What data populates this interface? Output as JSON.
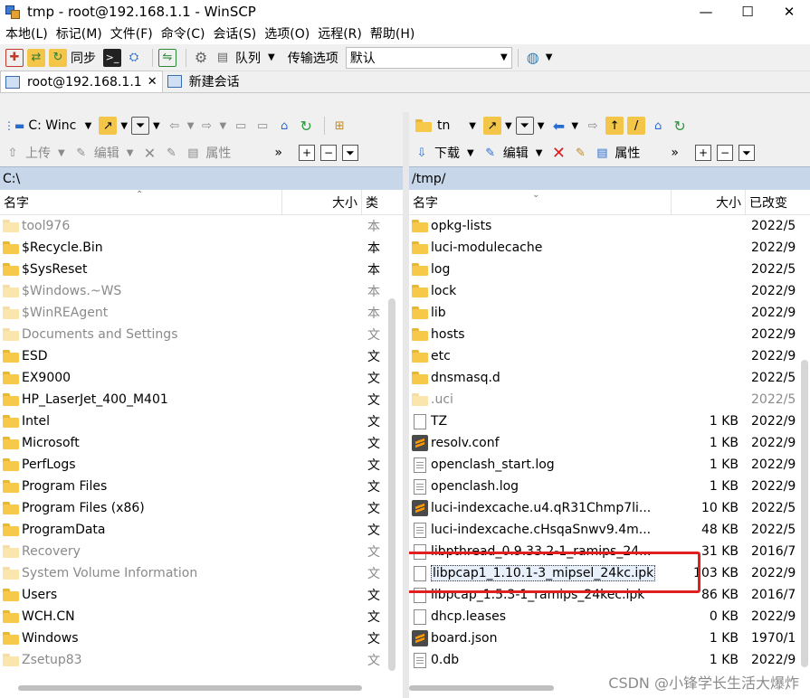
{
  "window": {
    "title": "tmp - root@192.168.1.1 - WinSCP",
    "controls": {
      "minimize": "—",
      "maximize": "☐",
      "close": "✕"
    }
  },
  "menu": [
    "本地(L)",
    "标记(M)",
    "文件(F)",
    "命令(C)",
    "会话(S)",
    "选项(O)",
    "远程(R)",
    "帮助(H)"
  ],
  "toolbar": {
    "sync_label": "同步",
    "queue_label": "队列",
    "transfer_label": "传输选项",
    "transfer_value": "默认"
  },
  "tabs": [
    {
      "label": "root@192.168.1.1",
      "close": "✕"
    },
    {
      "label": "新建会话"
    }
  ],
  "left": {
    "drive": "C: Winc",
    "upload": "上传",
    "edit": "编辑",
    "properties": "属性",
    "more": "»",
    "path": "C:\\",
    "columns": {
      "name": "名字",
      "size": "大小",
      "type": "类"
    },
    "rows": [
      {
        "name": "tool976",
        "type": "本",
        "dim": true
      },
      {
        "name": "$Recycle.Bin",
        "type": "本",
        "dim": false
      },
      {
        "name": "$SysReset",
        "type": "本",
        "dim": false
      },
      {
        "name": "$Windows.~WS",
        "type": "本",
        "dim": true
      },
      {
        "name": "$WinREAgent",
        "type": "本",
        "dim": true
      },
      {
        "name": "Documents and Settings",
        "type": "文",
        "dim": true
      },
      {
        "name": "ESD",
        "type": "文",
        "dim": false
      },
      {
        "name": "EX9000",
        "type": "文",
        "dim": false
      },
      {
        "name": "HP_LaserJet_400_M401",
        "type": "文",
        "dim": false
      },
      {
        "name": "Intel",
        "type": "文",
        "dim": false
      },
      {
        "name": "Microsoft",
        "type": "文",
        "dim": false
      },
      {
        "name": "PerfLogs",
        "type": "文",
        "dim": false
      },
      {
        "name": "Program Files",
        "type": "文",
        "dim": false
      },
      {
        "name": "Program Files (x86)",
        "type": "文",
        "dim": false
      },
      {
        "name": "ProgramData",
        "type": "文",
        "dim": false
      },
      {
        "name": "Recovery",
        "type": "文",
        "dim": true
      },
      {
        "name": "System Volume Information",
        "type": "文",
        "dim": true
      },
      {
        "name": "Users",
        "type": "文",
        "dim": false
      },
      {
        "name": "WCH.CN",
        "type": "文",
        "dim": false
      },
      {
        "name": "Windows",
        "type": "文",
        "dim": false
      },
      {
        "name": "Zsetup83",
        "type": "文",
        "dim": true
      }
    ]
  },
  "right": {
    "dir_combo": "tn",
    "download": "下载",
    "edit": "编辑",
    "properties": "属性",
    "more": "»",
    "path": "/tmp/",
    "columns": {
      "name": "名字",
      "size": "大小",
      "modified": "已改变"
    },
    "rows": [
      {
        "name": "opkg-lists",
        "size": "",
        "date": "2022/5",
        "icon": "folder"
      },
      {
        "name": "luci-modulecache",
        "size": "",
        "date": "2022/9",
        "icon": "folder"
      },
      {
        "name": "log",
        "size": "",
        "date": "2022/5",
        "icon": "folder"
      },
      {
        "name": "lock",
        "size": "",
        "date": "2022/9",
        "icon": "folder"
      },
      {
        "name": "lib",
        "size": "",
        "date": "2022/9",
        "icon": "folder"
      },
      {
        "name": "hosts",
        "size": "",
        "date": "2022/9",
        "icon": "folder"
      },
      {
        "name": "etc",
        "size": "",
        "date": "2022/9",
        "icon": "folder"
      },
      {
        "name": "dnsmasq.d",
        "size": "",
        "date": "2022/5",
        "icon": "folder"
      },
      {
        "name": ".uci",
        "size": "",
        "date": "2022/5",
        "icon": "folder-dim"
      },
      {
        "name": "TZ",
        "size": "1 KB",
        "date": "2022/9",
        "icon": "file"
      },
      {
        "name": "resolv.conf",
        "size": "1 KB",
        "date": "2022/9",
        "icon": "sublime"
      },
      {
        "name": "openclash_start.log",
        "size": "1 KB",
        "date": "2022/9",
        "icon": "txt"
      },
      {
        "name": "openclash.log",
        "size": "1 KB",
        "date": "2022/9",
        "icon": "txt"
      },
      {
        "name": "luci-indexcache.u4.qR31Chmp7li...",
        "size": "10 KB",
        "date": "2022/5",
        "icon": "sublime"
      },
      {
        "name": "luci-indexcache.cHsqaSnwv9.4m...",
        "size": "48 KB",
        "date": "2022/5",
        "icon": "txt"
      },
      {
        "name": "libpthread_0.9.33.2-1_ramips_24...",
        "size": "31 KB",
        "date": "2016/7",
        "icon": "file"
      },
      {
        "name": "libpcap1_1.10.1-3_mipsel_24kc.ipk",
        "size": "103 KB",
        "date": "2022/9",
        "icon": "file",
        "selected": true
      },
      {
        "name": "libpcap_1.5.3-1_ramips_24kec.ipk",
        "size": "86 KB",
        "date": "2016/7",
        "icon": "file"
      },
      {
        "name": "dhcp.leases",
        "size": "0 KB",
        "date": "2022/9",
        "icon": "file"
      },
      {
        "name": "board.json",
        "size": "1 KB",
        "date": "1970/1",
        "icon": "sublime"
      },
      {
        "name": "0.db",
        "size": "1 KB",
        "date": "2022/9",
        "icon": "txt"
      }
    ]
  },
  "watermark": "CSDN @小锋学长生活大爆炸",
  "colors": {
    "path_bar": "#c7d6e8",
    "highlight_box": "#e02020",
    "folder": "#f6c94a"
  }
}
